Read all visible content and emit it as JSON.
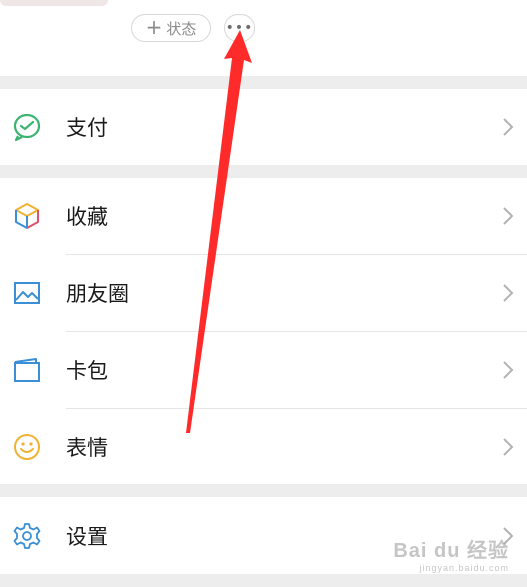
{
  "profile": {
    "status_button": {
      "icon": "plus-icon",
      "label": "状态"
    },
    "more_button": {
      "icon": "more-dots-icon"
    }
  },
  "menu": {
    "pay": {
      "label": "支付",
      "icon": "pay-icon",
      "color": "#3cb371"
    },
    "favorites": {
      "label": "收藏",
      "icon": "cube-icon"
    },
    "moments": {
      "label": "朋友圈",
      "icon": "picture-icon",
      "color": "#3a8fd6"
    },
    "cards": {
      "label": "卡包",
      "icon": "card-wallet-icon",
      "color": "#3a8fd6"
    },
    "stickers": {
      "label": "表情",
      "icon": "smiley-icon",
      "color": "#f0b233"
    },
    "settings": {
      "label": "设置",
      "icon": "gear-icon",
      "color": "#3a8fd6"
    }
  },
  "annotation": {
    "arrow_color": "#ff2a2a",
    "points_to": "more-button"
  },
  "watermark": {
    "main": "Bai du 经验",
    "sub": "jingyan.baidu.com"
  },
  "colors": {
    "page_bg": "#ededed",
    "row_bg": "#ffffff",
    "chevron": "#b2b2b2"
  }
}
